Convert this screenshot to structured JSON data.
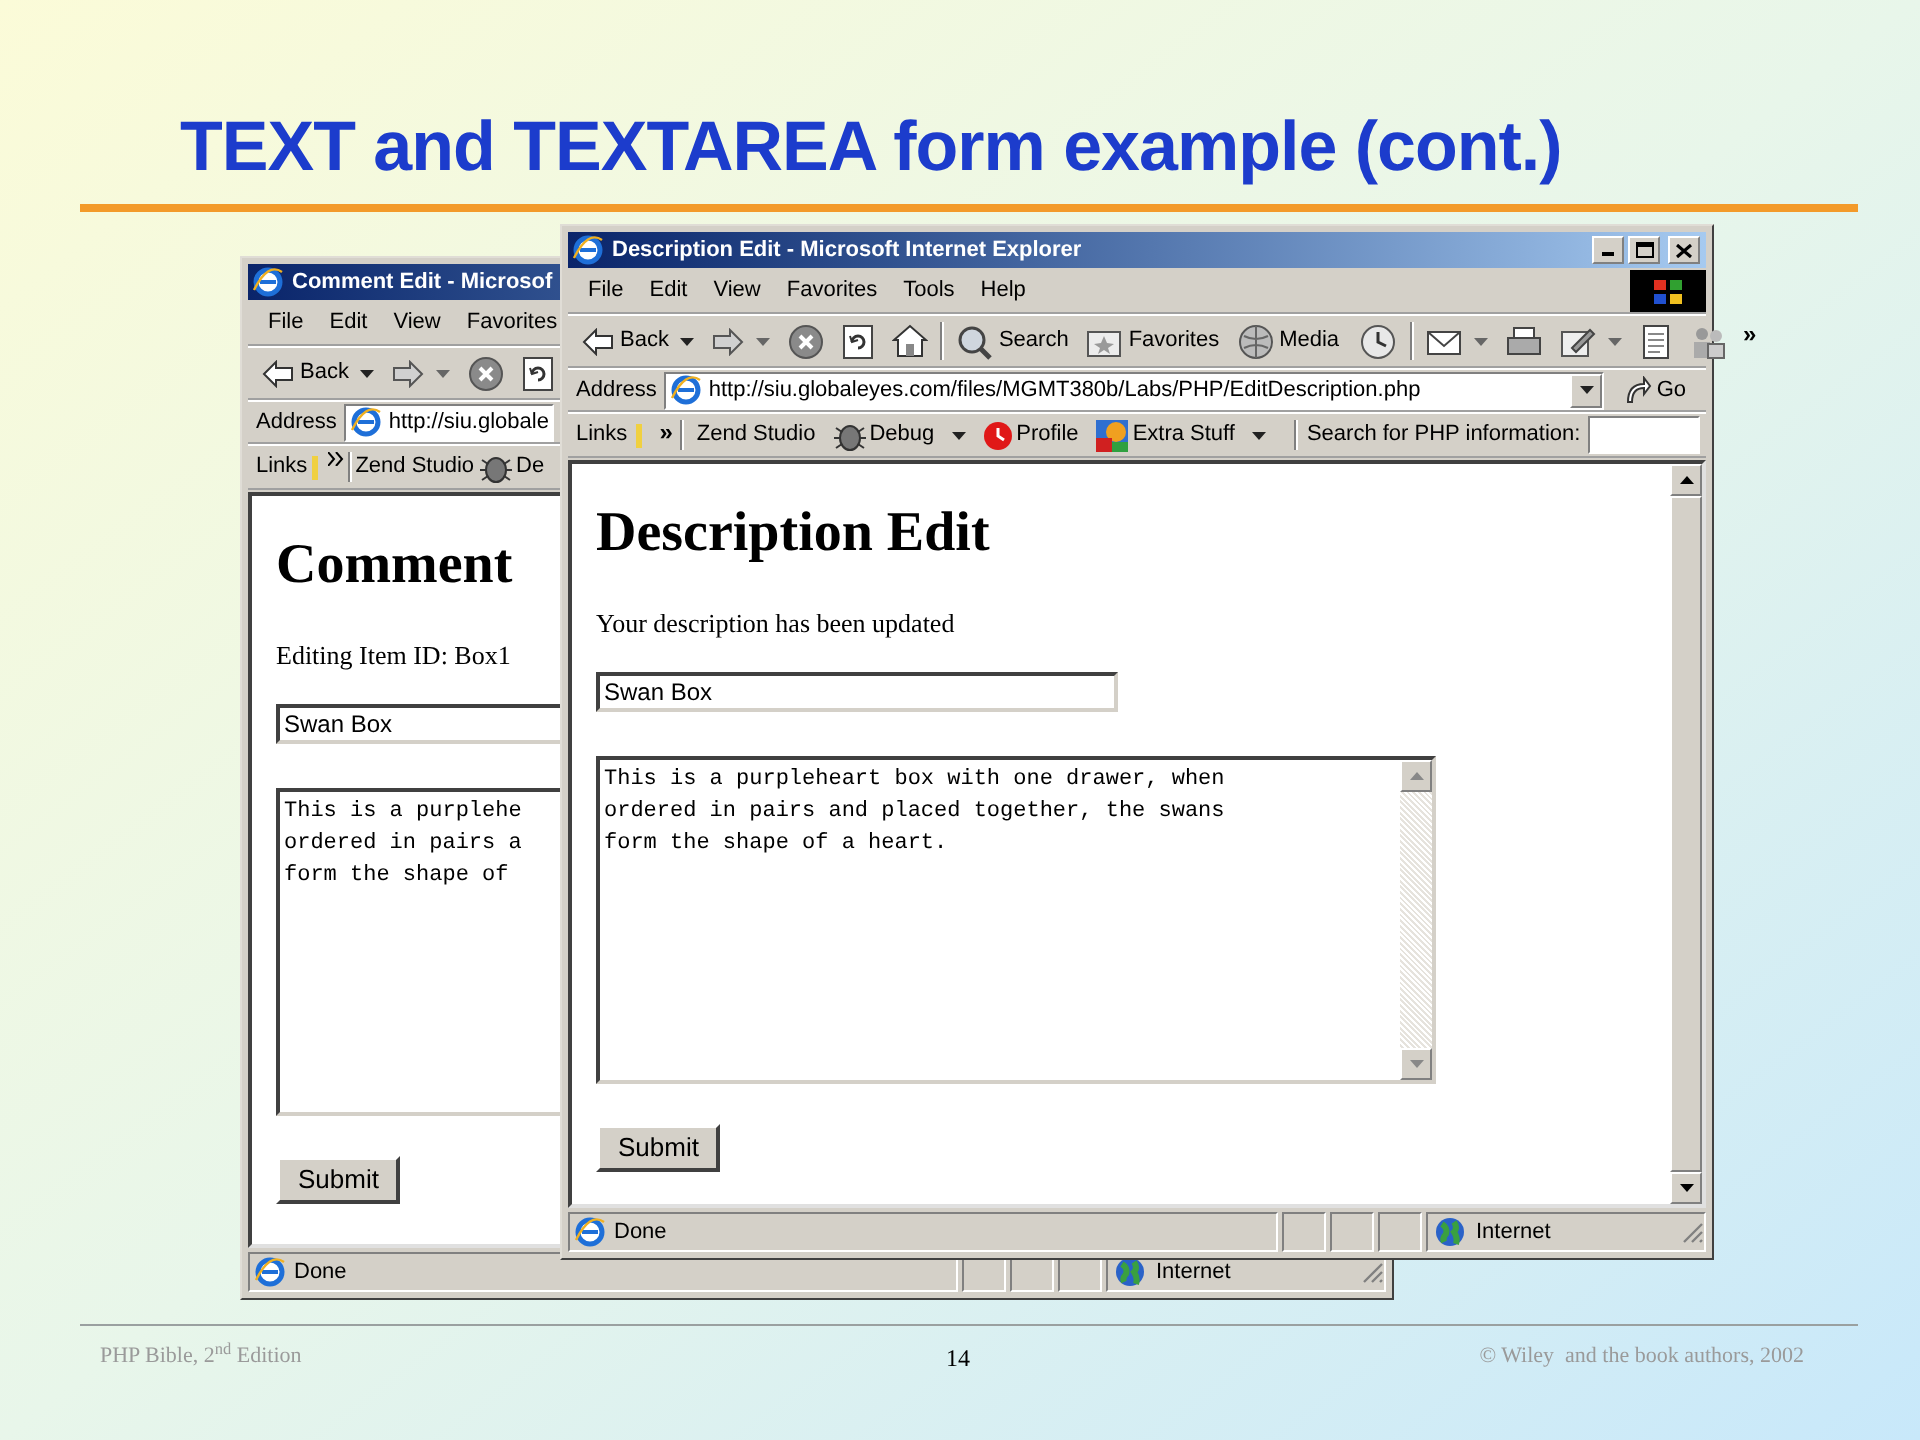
{
  "slide": {
    "title": "TEXT and TEXTAREA form example (cont.)",
    "footer": {
      "left": "PHP Bible, 2$^{nd}$ Edition",
      "page": "14",
      "right": "© Wiley  and the book authors, 2002"
    }
  },
  "windows": [
    {
      "title": "Comment Edit - Microsof",
      "menu": [
        "File",
        "Edit",
        "View",
        "Favorites"
      ],
      "toolbar": [
        {
          "kind": "back",
          "label": "Back",
          "dropdown": true
        },
        {
          "kind": "forward",
          "dropdown": true
        },
        {
          "kind": "stop"
        },
        {
          "kind": "refresh"
        }
      ],
      "address_label": "Address",
      "address": "http://siu.globale",
      "links_label": "Links",
      "links": [
        {
          "kind": "plain",
          "label": "Zend Studio"
        },
        {
          "kind": "debug",
          "label": "De"
        }
      ],
      "page": {
        "heading": "Comment",
        "message": "Editing Item ID: Box1",
        "name_value": "Swan Box",
        "description_lines": [
          "This is a purplehe",
          "ordered in pairs a",
          "form the shape of"
        ],
        "submit": "Submit"
      },
      "status": "Done",
      "zone": "Internet"
    },
    {
      "title": "Description Edit - Microsoft Internet Explorer",
      "window_buttons": true,
      "menu": [
        "File",
        "Edit",
        "View",
        "Favorites",
        "Tools",
        "Help"
      ],
      "throbber": true,
      "toolbar": [
        {
          "kind": "back",
          "label": "Back",
          "dropdown": true
        },
        {
          "kind": "forward",
          "dropdown": true
        },
        {
          "kind": "stop"
        },
        {
          "kind": "refresh"
        },
        {
          "kind": "home"
        },
        {
          "kind": "separator"
        },
        {
          "kind": "search",
          "label": "Search"
        },
        {
          "kind": "favorites",
          "label": "Favorites"
        },
        {
          "kind": "media",
          "label": "Media"
        },
        {
          "kind": "history"
        },
        {
          "kind": "separator"
        },
        {
          "kind": "mail",
          "dropdown": true
        },
        {
          "kind": "print"
        },
        {
          "kind": "edit",
          "dropdown": true
        },
        {
          "kind": "discuss"
        },
        {
          "kind": "messenger"
        }
      ],
      "toolbar_overflow": "»",
      "address_label": "Address",
      "address": "http://siu.globaleyes.com/files/MGMT380b/Labs/PHP/EditDescription.php",
      "go_button": "Go",
      "links_label": "Links",
      "links": [
        {
          "kind": "plain",
          "label": "Zend Studio"
        },
        {
          "kind": "debug",
          "label": "Debug",
          "dropdown": true
        },
        {
          "kind": "profile",
          "label": "Profile"
        },
        {
          "kind": "extra",
          "label": "Extra Stuff",
          "dropdown": true
        }
      ],
      "search_label": "Search for PHP information:",
      "page": {
        "heading": "Description Edit",
        "message": "Your description has been updated",
        "name_value": "Swan Box",
        "description_lines": [
          "This is a purpleheart box with one drawer, when",
          "ordered in pairs and placed together, the swans",
          "form the shape of a heart."
        ],
        "submit": "Submit"
      },
      "scrollbar": true,
      "status": "Done",
      "zone": "Internet"
    }
  ]
}
